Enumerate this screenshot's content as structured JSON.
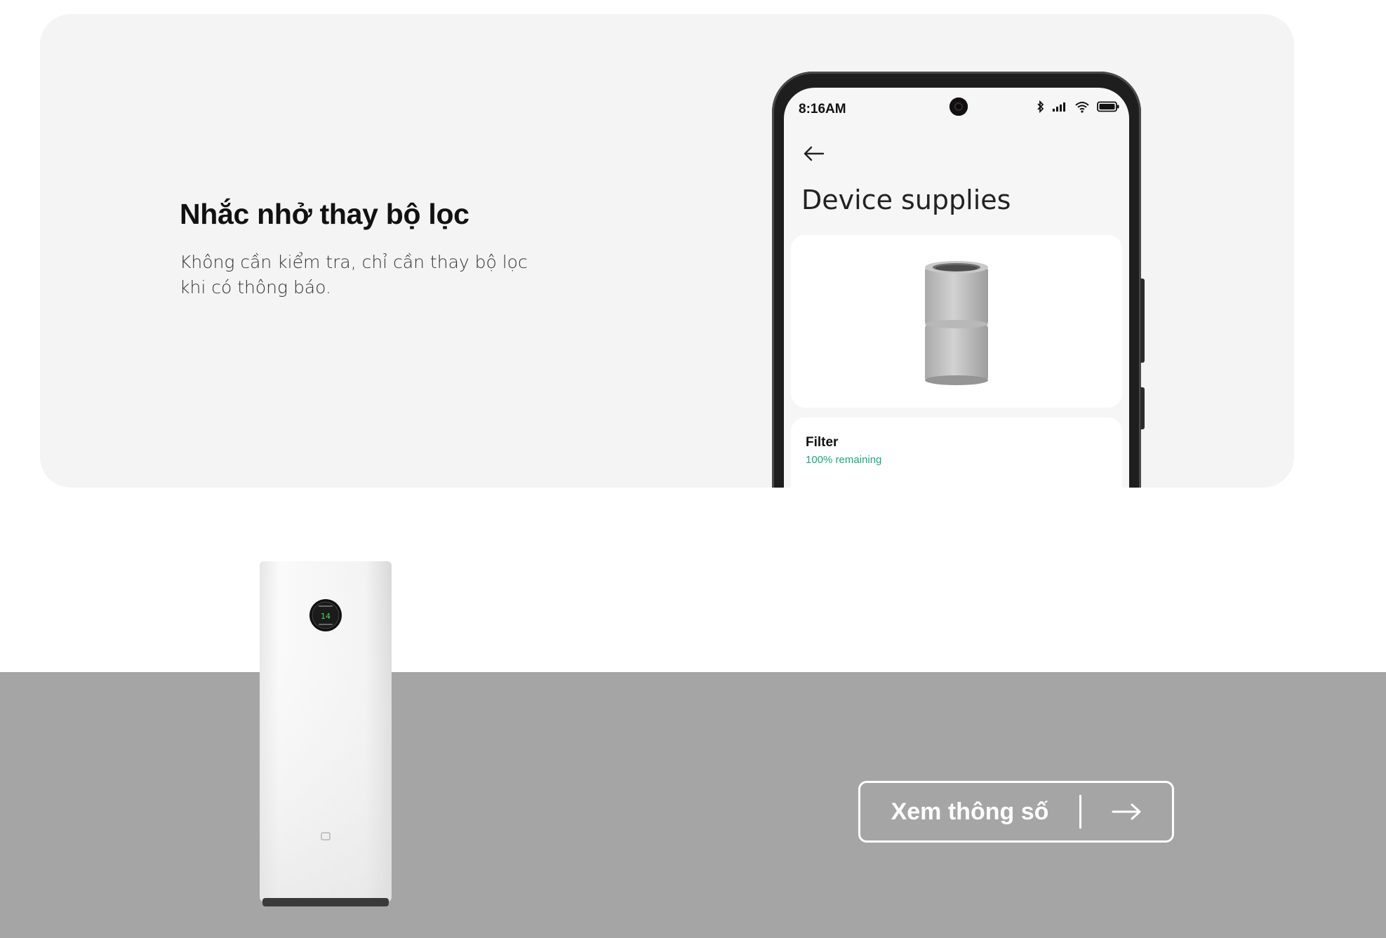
{
  "feature": {
    "title": "Nhắc nhở thay bộ lọc",
    "description": "Không cần kiểm tra, chỉ cần thay bộ lọc khi có thông báo."
  },
  "phone": {
    "status_time": "8:16AM",
    "status_icons": [
      "bluetooth-icon",
      "signal-icon",
      "wifi-icon",
      "battery-icon"
    ],
    "screen_title": "Device supplies",
    "filter_label": "Filter",
    "filter_remaining": "100% remaining"
  },
  "specs_button": {
    "label": "Xem thông số",
    "icon": "arrow-right-icon"
  },
  "colors": {
    "card_bg": "#f4f4f4",
    "band_bg": "#a5a5a5",
    "remaining_green": "#1aaa7a"
  }
}
